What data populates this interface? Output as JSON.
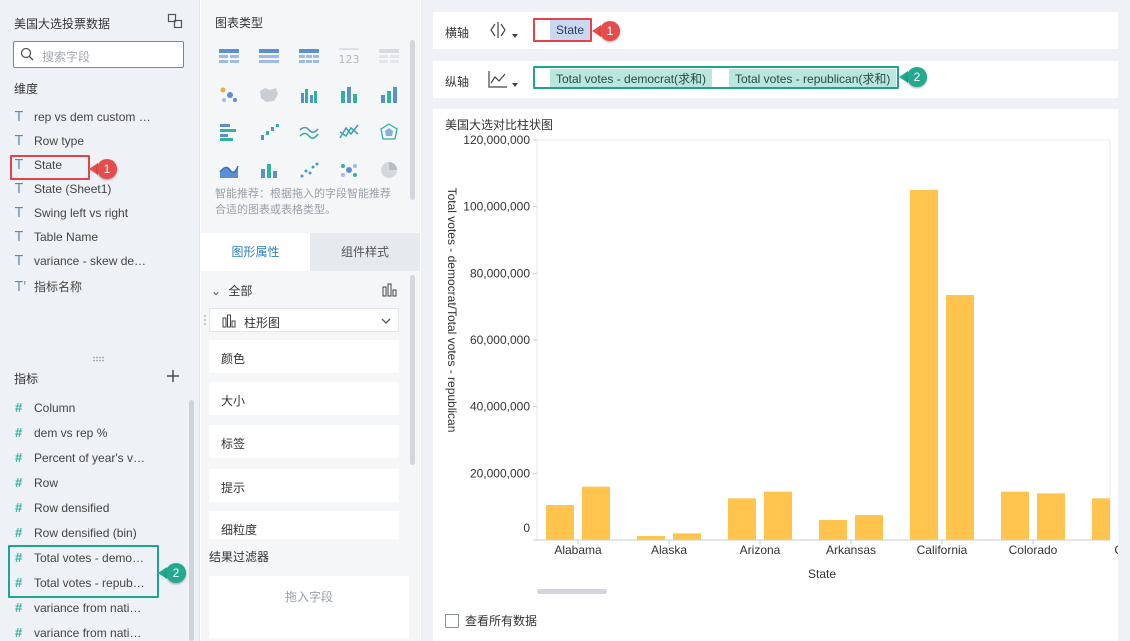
{
  "left_panel": {
    "dataset_title": "美国大选投票数据",
    "search_placeholder": "搜索字段",
    "dimensions_label": "维度",
    "dimensions": [
      {
        "label": "rep vs dem custom …",
        "icon": "text-type-icon"
      },
      {
        "label": "Row type",
        "icon": "text-type-icon"
      },
      {
        "label": "State",
        "icon": "text-type-icon"
      },
      {
        "label": "State (Sheet1)",
        "icon": "text-type-icon"
      },
      {
        "label": "Swing left vs right",
        "icon": "text-type-icon"
      },
      {
        "label": "Table Name",
        "icon": "text-type-icon"
      },
      {
        "label": "variance - skew de…",
        "icon": "text-type-icon"
      },
      {
        "label": "指标名称",
        "icon": "text-type-icon"
      }
    ],
    "measures_label": "指标",
    "measures": [
      {
        "label": "Column"
      },
      {
        "label": "dem vs rep %"
      },
      {
        "label": "Percent of year's v…"
      },
      {
        "label": "Row"
      },
      {
        "label": "Row densified"
      },
      {
        "label": "Row densified (bin)"
      },
      {
        "label": "Total votes - demo…"
      },
      {
        "label": "Total votes - repub…"
      },
      {
        "label": "variance from nati…"
      },
      {
        "label": "variance from nati…"
      }
    ]
  },
  "middle_panel": {
    "chart_type_title": "图表类型",
    "hint": "智能推荐：根据拖入的字段智能推荐合适的图表或表格类型。",
    "tabs": [
      "图形属性",
      "组件样式"
    ],
    "all_label": "全部",
    "chart_type_selected": "柱形图",
    "properties": [
      "颜色",
      "大小",
      "标签",
      "提示",
      "细粒度"
    ],
    "result_filter_title": "结果过滤器",
    "drop_field_hint": "拖入字段"
  },
  "shelves": {
    "x_label": "横轴",
    "x_pills": [
      "State"
    ],
    "y_label": "纵轴",
    "y_pills": [
      "Total votes - democrat(求和)",
      "Total votes - republican(求和)"
    ]
  },
  "callouts": {
    "one": "1",
    "two": "2"
  },
  "chart": {
    "card_title": "美国大选对比柱状图",
    "see_all_label": "查看所有数据"
  },
  "chart_data": {
    "type": "bar",
    "xlabel": "State",
    "ylabel": "Total votes - democrat/Total votes - republican",
    "ylim": [
      0,
      120000000
    ],
    "yticks": [
      "0",
      "20,000,000",
      "40,000,000",
      "60,000,000",
      "80,000,000",
      "100,000,000",
      "120,000,000"
    ],
    "categories": [
      "Alabama",
      "Alaska",
      "Arizona",
      "Arkansas",
      "California",
      "Colorado",
      "Cor"
    ],
    "series": [
      {
        "values": [
          10500000,
          1200000,
          12500000,
          6000000,
          105000000,
          14500000,
          12500000
        ]
      },
      {
        "values": [
          16000000,
          2000000,
          14500000,
          7500000,
          73500000,
          14000000,
          null
        ]
      }
    ],
    "bar_color": "#ffc44d",
    "grid": false
  }
}
